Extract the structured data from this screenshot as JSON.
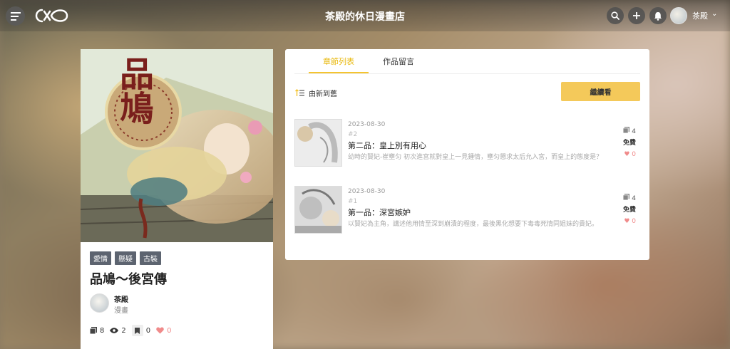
{
  "header": {
    "site_title": "茶殿的休日漫畫店",
    "username": "茶殿"
  },
  "manga": {
    "cover_text": "品鳩",
    "tags": [
      "愛情",
      "懸疑",
      "古裝"
    ],
    "title": "品鳩〜後宮傳",
    "author": {
      "name": "茶殿",
      "role": "漫畫"
    },
    "stats": {
      "chapters": "8",
      "views": "2",
      "bookmarks": "0",
      "likes": "0"
    }
  },
  "panel": {
    "tabs": [
      "章節列表",
      "作品留言"
    ],
    "active_tab": 0,
    "sort_label": "由新到舊",
    "continue_label": "繼續看",
    "chapters": [
      {
        "date": "2023-08-30",
        "number": "#2",
        "title": "第二品：皇上別有用心",
        "desc": "幼時的賢妃-崔壅匀 初次進宮就對皇上一見鍾情，壅匀懇求太后允入宮，而皇上的態度是？",
        "pages": "4",
        "price": "免費",
        "likes": "0"
      },
      {
        "date": "2023-08-30",
        "number": "#1",
        "title": "第一品：深宮嫉妒",
        "desc": "以賢妃為主角，講述他用情至深到崩潰的程度，最後黑化想要下毒毒死情同姐妹的貴妃。",
        "pages": "4",
        "price": "免費",
        "likes": "0"
      }
    ]
  },
  "colors": {
    "accent": "#f4c430",
    "tag_bg": "#5d6470",
    "like": "#f08a8a"
  }
}
